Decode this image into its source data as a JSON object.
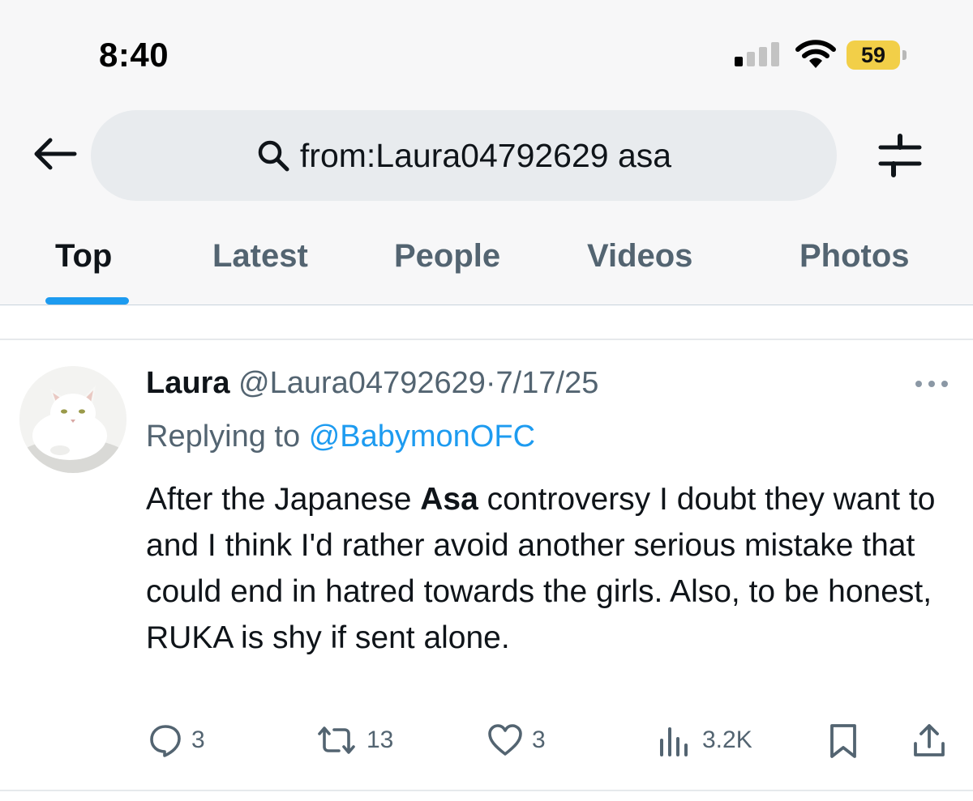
{
  "status": {
    "time": "8:40",
    "battery": "59"
  },
  "search": {
    "query": "from:Laura04792629 asa"
  },
  "tabs": [
    {
      "label": "Top",
      "active": true
    },
    {
      "label": "Latest",
      "active": false
    },
    {
      "label": "People",
      "active": false
    },
    {
      "label": "Videos",
      "active": false
    },
    {
      "label": "Photos",
      "active": false
    }
  ],
  "tweet": {
    "author_name": "Laura",
    "author_handle": "@Laura04792629",
    "separator": "·",
    "date": "7/17/25",
    "replying_prefix": "Replying to",
    "replying_to": "@BabymonOFC",
    "text_before": "After the Japanese ",
    "text_highlight": "Asa",
    "text_after": " controversy I doubt they want to and I think I'd rather avoid another serious mistake that could end in hatred towards the girls. Also, to be honest, RUKA is shy if sent alone.",
    "actions": {
      "replies": "3",
      "reposts": "13",
      "likes": "3",
      "views": "3.2K"
    }
  },
  "icons": {
    "back": "arrow-left-icon",
    "search": "search-icon",
    "filter": "sliders-icon",
    "more": "more-dots-icon",
    "reply": "speech-bubble-icon",
    "repost": "repost-icon",
    "like": "heart-icon",
    "views": "bar-chart-icon",
    "bookmark": "bookmark-icon",
    "share": "share-icon"
  },
  "colors": {
    "accent": "#1d9bf0",
    "secondary_text": "#536471",
    "battery": "#f2cf48"
  }
}
